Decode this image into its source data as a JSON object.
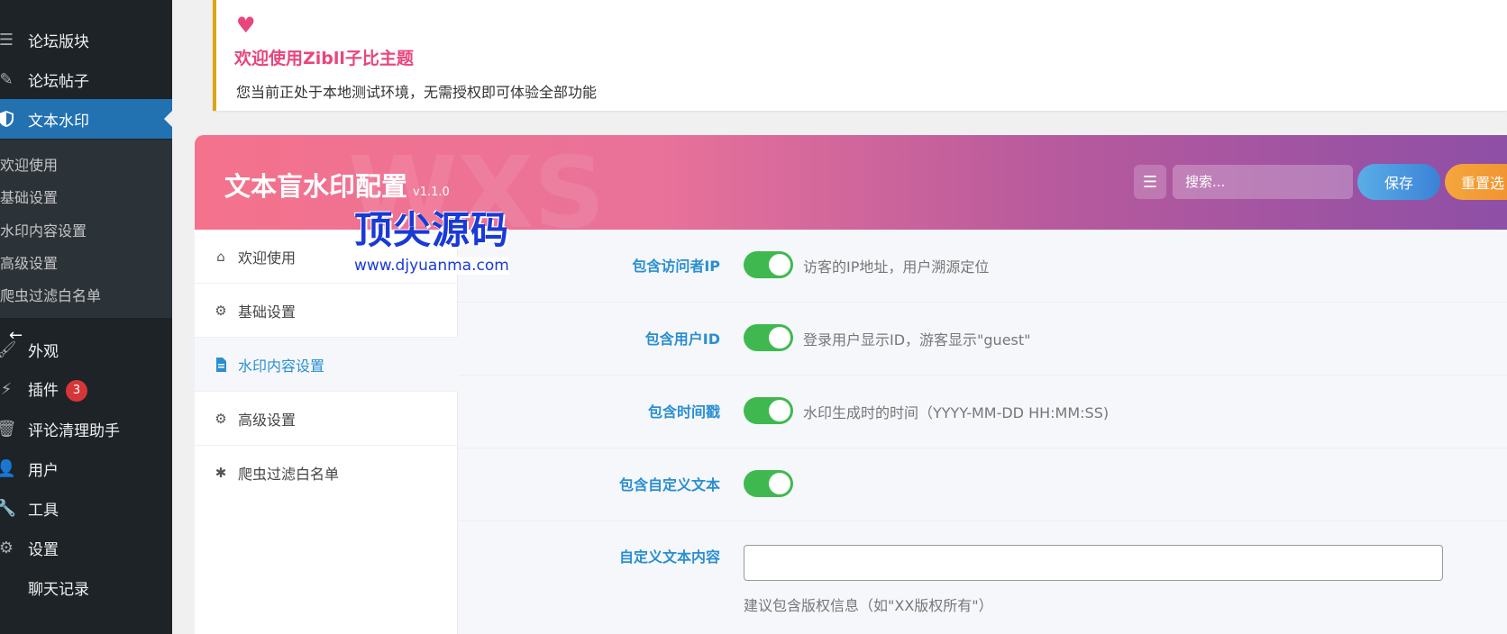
{
  "sidebar": {
    "items": [
      {
        "label": "论坛版块",
        "icon": "forum-icon"
      },
      {
        "label": "论坛帖子",
        "icon": "pen-icon"
      },
      {
        "label": "文本水印",
        "icon": "shield-icon"
      }
    ],
    "submenu": [
      "欢迎使用",
      "基础设置",
      "水印内容设置",
      "高级设置",
      "爬虫过滤白名单"
    ],
    "items2": [
      {
        "label": "外观",
        "icon": "brush-icon"
      },
      {
        "label": "插件",
        "icon": "plugin-icon",
        "badge": "3"
      },
      {
        "label": "评论清理助手",
        "icon": "trash-icon"
      },
      {
        "label": "用户",
        "icon": "user-icon"
      },
      {
        "label": "工具",
        "icon": "wrench-icon"
      },
      {
        "label": "设置",
        "icon": "settings-icon"
      },
      {
        "label": "聊天记录",
        "icon": ""
      }
    ]
  },
  "notice": {
    "title": "欢迎使用Zibll子比主题",
    "text": "您当前正处于本地测试环境，无需授权即可体验全部功能"
  },
  "panel": {
    "title": "文本盲水印配置",
    "version": "v1.1.0",
    "search_placeholder": "搜索...",
    "save_label": "保存",
    "reset_label": "重置选",
    "watermark_text": "WXS"
  },
  "stamp": {
    "title": "顶尖源码",
    "url": "www.djyuanma.com"
  },
  "nav": [
    {
      "label": "欢迎使用",
      "icon": "home-icon"
    },
    {
      "label": "基础设置",
      "icon": "gear-icon"
    },
    {
      "label": "水印内容设置",
      "icon": "document-icon",
      "active": true
    },
    {
      "label": "高级设置",
      "icon": "gears-icon"
    },
    {
      "label": "爬虫过滤白名单",
      "icon": "bug-icon"
    }
  ],
  "settings": {
    "ip": {
      "label": "包含访问者IP",
      "desc": "访客的IP地址，用户溯源定位",
      "enabled": true
    },
    "user_id": {
      "label": "包含用户ID",
      "desc": "登录用户显示ID，游客显示\"guest\"",
      "enabled": true
    },
    "timestamp": {
      "label": "包含时间戳",
      "desc": "水印生成时的时间（YYYY-MM-DD HH:MM:SS)",
      "enabled": true
    },
    "custom_text": {
      "label": "包含自定义文本",
      "enabled": true
    },
    "custom_content": {
      "label": "自定义文本内容",
      "value": "",
      "hint": "建议包含版权信息（如\"XX版权所有\"）"
    }
  },
  "colors": {
    "accent": "#2a8fd0",
    "toggle_on": "#3fb94f",
    "notice_title": "#e8467c",
    "admin_bg": "#1d2327",
    "admin_active": "#2271b1"
  }
}
